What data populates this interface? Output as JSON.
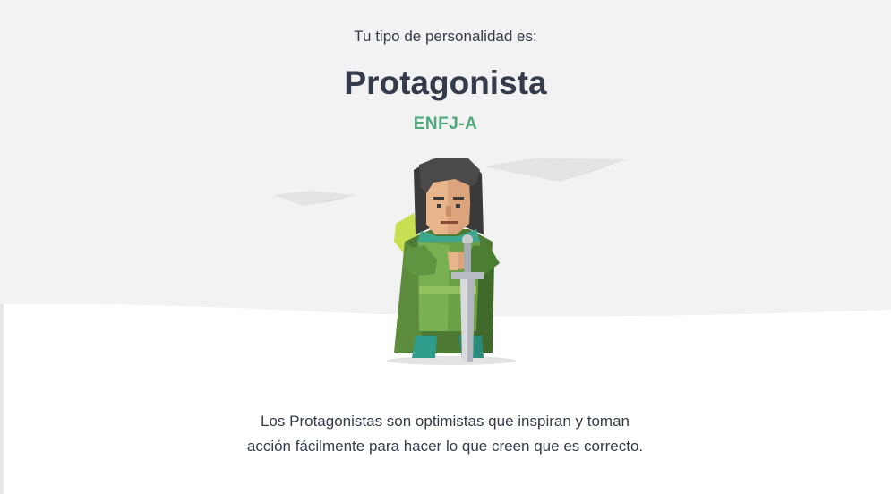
{
  "colors": {
    "accent": "#4fa97a",
    "text": "#343c4b",
    "background_top": "#f2f2f3",
    "background_bottom": "#ffffff"
  },
  "result": {
    "intro": "Tu tipo de personalidad es:",
    "type_name": "Protagonista",
    "type_code": "ENFJ-A"
  },
  "description": {
    "line_1": "Los Protagonistas son optimistas que inspiran y toman",
    "line_2": "acción fácilmente para hacer lo que creen que es correcto."
  },
  "illustration": {
    "icon": "protagonist-character-icon"
  }
}
